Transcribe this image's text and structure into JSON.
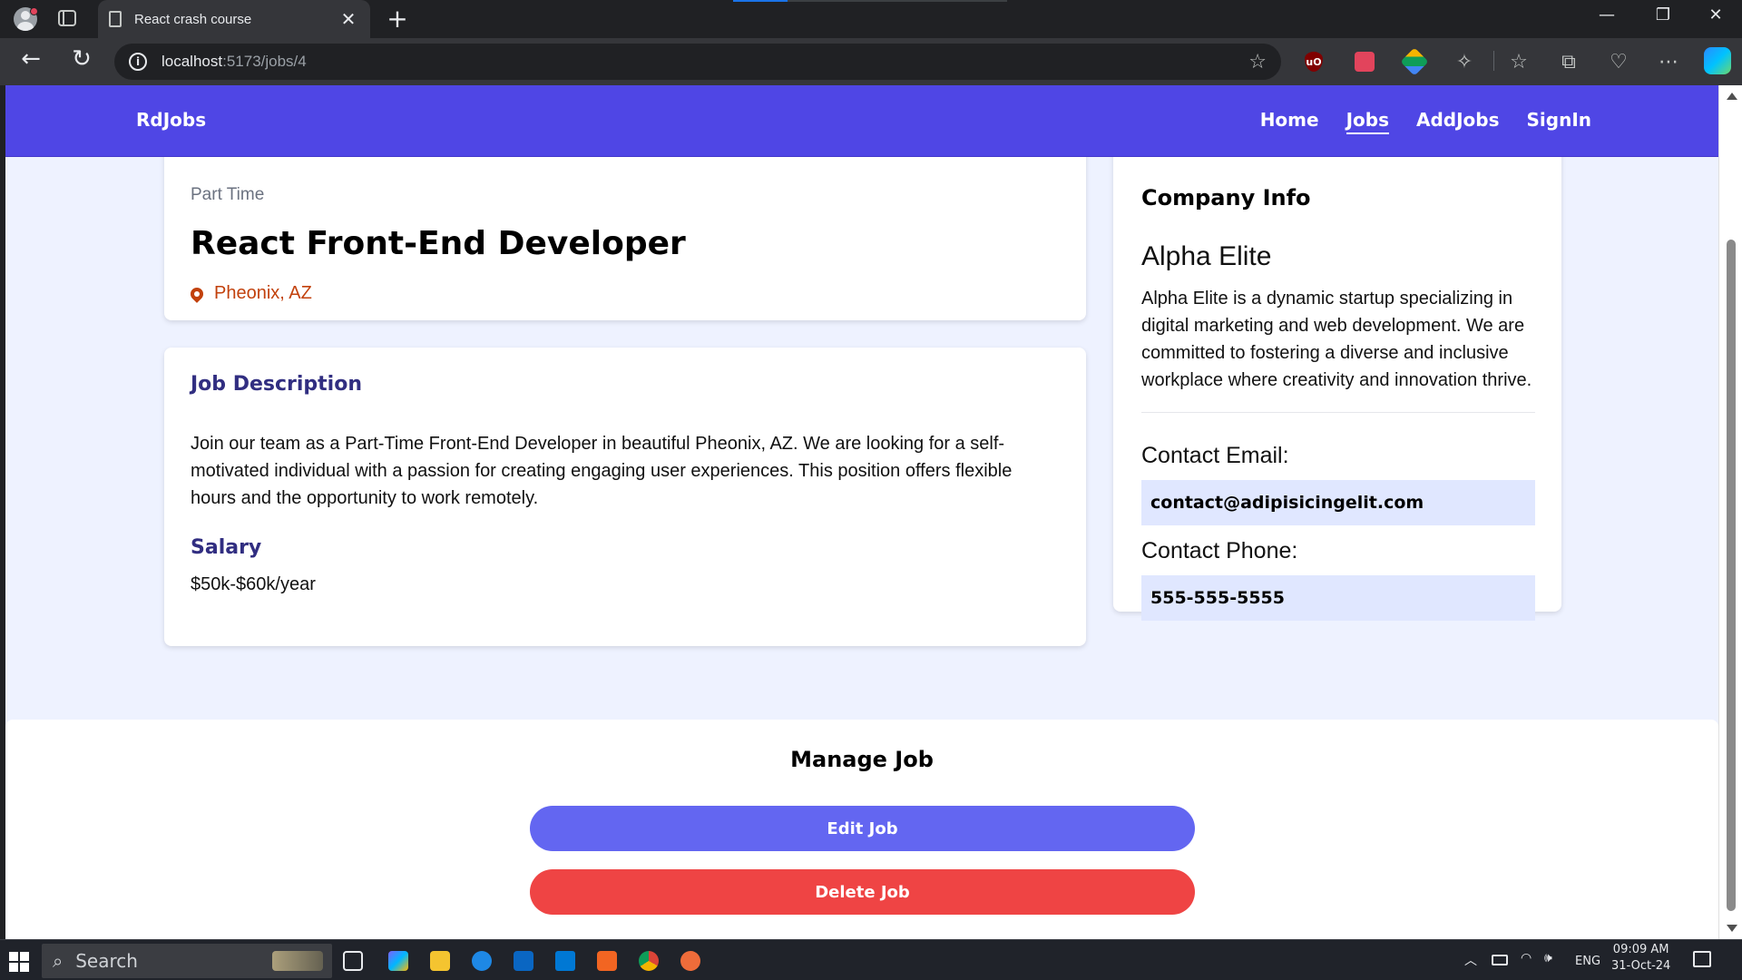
{
  "browser": {
    "tab_title": "React crash course",
    "tab_close": "✕",
    "new_tab": "+",
    "url_host": "localhost",
    "url_path": ":5173/jobs/4",
    "window_controls": [
      "—",
      "❐",
      "✕"
    ],
    "nav_icons": {
      "back": "←",
      "reload": "↻"
    },
    "extension_icons": [
      "ublock-origin-icon",
      "red-extension-icon",
      "green-extension-icon",
      "puzzle-extensions-icon",
      "favorites-icon",
      "collections-icon",
      "browser-essentials-icon",
      "more-options-icon",
      "copilot-icon"
    ],
    "ublock_label": "uO",
    "puzzle_glyph": "✧",
    "favorites_glyph": "☆",
    "collections_glyph": "⧉",
    "essentials_glyph": "♡",
    "more_glyph": "⋯",
    "star_glyph": "☆"
  },
  "site": {
    "brand": "RdJobs",
    "nav": [
      "Home",
      "Jobs",
      "AddJobs",
      "SignIn"
    ],
    "active_nav": "Jobs",
    "accent": "#4f46e5"
  },
  "job": {
    "type": "Part Time",
    "title": "React Front-End Developer",
    "location": "Pheonix, AZ",
    "description_heading": "Job Description",
    "description": "Join our team as a Part-Time Front-End Developer in beautiful Pheonix, AZ. We are looking for a self-motivated individual with a passion for creating engaging user experiences. This position offers flexible hours and the opportunity to work remotely.",
    "salary_heading": "Salary",
    "salary": "$50k-$60k/year"
  },
  "company": {
    "heading": "Company Info",
    "name": "Alpha Elite",
    "description": "Alpha Elite is a dynamic startup specializing in digital marketing and web development. We are committed to fostering a diverse and inclusive workplace where creativity and innovation thrive.",
    "email_label": "Contact Email:",
    "email": "contact@adipisicingelit.com",
    "phone_label": "Contact Phone:",
    "phone": "555-555-5555"
  },
  "manage": {
    "heading": "Manage Job",
    "edit_label": "Edit Job",
    "delete_label": "Delete Job",
    "edit_color": "#6366f1",
    "delete_color": "#ef4444"
  },
  "taskbar": {
    "search_placeholder": "Search",
    "search_glyph": "⌕",
    "language": "ENG",
    "time": "09:09 AM",
    "date": "31-Oct-24",
    "tray_chevron": "︿",
    "tray_wifi": "◠",
    "tray_volume": "🕪"
  }
}
